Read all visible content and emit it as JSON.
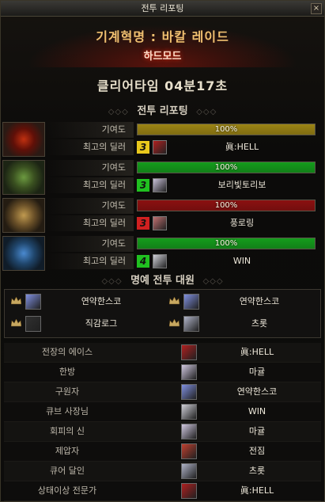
{
  "window": {
    "title": "전투 리포팅",
    "close_label": "×"
  },
  "header": {
    "raid_name": "기계혁명 : 바칼 레이드",
    "mode": "하드모드"
  },
  "clear_time": "클리어타임  04분17초",
  "battle_report": {
    "title": "전투 리포팅",
    "contribution_label": "기여도",
    "top_dealer_label": "최고의 딜러",
    "bosses": [
      {
        "boss": "red-boss",
        "bar_color": "#9c8414",
        "contribution": "100%",
        "rank_badge": "3",
        "badge_color": "#e8c81c",
        "dealer": "眞:HELL",
        "avatar_color": "#b02020"
      },
      {
        "boss": "green-boss",
        "bar_color": "#149c1c",
        "contribution": "100%",
        "rank_badge": "3",
        "badge_color": "#20c020",
        "dealer": "보리빛토리보",
        "avatar_color": "#c8c0d8"
      },
      {
        "boss": "gold-boss",
        "bar_color": "#8c1010",
        "contribution": "100%",
        "rank_badge": "3",
        "badge_color": "#d02020",
        "dealer": "풍로링",
        "avatar_color": "#c07070"
      },
      {
        "boss": "blue-boss",
        "bar_color": "#149c1c",
        "contribution": "100%",
        "rank_badge": "4",
        "badge_color": "#20c020",
        "dealer": "WIN",
        "avatar_color": "#d0d0d8"
      }
    ]
  },
  "honor": {
    "title": "명예 전투 대원",
    "members": [
      {
        "name": "연약한스코",
        "avatar_color": "#8090e0"
      },
      {
        "name": "연약한스코",
        "avatar_color": "#8090e0"
      },
      {
        "name": "직감로그",
        "avatar_color": "#303030"
      },
      {
        "name": "츠롯",
        "avatar_color": "#b0b4c8"
      }
    ]
  },
  "awards": [
    {
      "title": "전장의 에이스",
      "name": "眞:HELL",
      "avatar_color": "#b02020"
    },
    {
      "title": "한방",
      "name": "마귤",
      "avatar_color": "#d0c8e0"
    },
    {
      "title": "구원자",
      "name": "연약한스코",
      "avatar_color": "#8090e0"
    },
    {
      "title": "큐브 사장님",
      "name": "WIN",
      "avatar_color": "#d0d0d8"
    },
    {
      "title": "회피의 신",
      "name": "마귤",
      "avatar_color": "#d0c8e0"
    },
    {
      "title": "제압자",
      "name": "전짐",
      "avatar_color": "#c04030"
    },
    {
      "title": "큐어 달인",
      "name": "츠롯",
      "avatar_color": "#b0b4c8"
    },
    {
      "title": "상태이상 전문가",
      "name": "眞:HELL",
      "avatar_color": "#b02020"
    }
  ]
}
